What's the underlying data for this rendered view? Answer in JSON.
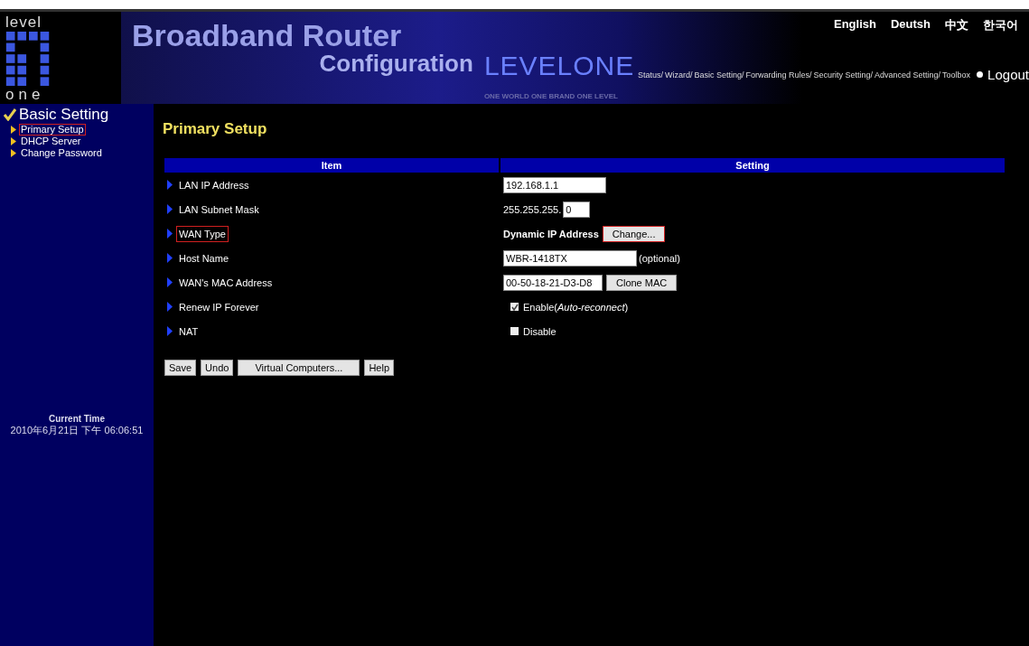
{
  "logo": {
    "top": "level",
    "bottom": "one"
  },
  "banner": {
    "title": "Broadband Router",
    "subtitle": "Configuration",
    "brand": "LEVELONE",
    "tagline": "ONE WORLD ONE BRAND ONE LEVEL"
  },
  "languages": [
    "English",
    "Deutsh",
    "中文",
    "한국어"
  ],
  "nav": [
    "Status/",
    "Wizard/",
    "Basic Setting/",
    "Forwarding Rules/",
    "Security Setting/",
    "Advanced Setting/",
    "Toolbox"
  ],
  "logout": "Logout",
  "sidebar": {
    "section": "Basic Setting",
    "items": [
      {
        "label": "Primary Setup",
        "highlighted": true
      },
      {
        "label": "DHCP Server",
        "highlighted": false
      },
      {
        "label": "Change Password",
        "highlighted": false
      }
    ],
    "time_label": "Current Time",
    "time": "2010年6月21日 下午 06:06:51"
  },
  "page_title": "Primary Setup",
  "table": {
    "columns": [
      "Item",
      "Setting"
    ],
    "rows": [
      {
        "label": "LAN IP Address",
        "highlighted": false,
        "kind": "input",
        "value": "192.168.1.1"
      },
      {
        "label": "LAN Subnet Mask",
        "highlighted": false,
        "kind": "prefix-input",
        "prefix": "255.255.255.",
        "value": "0"
      },
      {
        "label": "WAN Type",
        "highlighted": true,
        "kind": "text-button",
        "text": "Dynamic IP Address",
        "button": "Change...",
        "button_highlighted": true
      },
      {
        "label": "Host Name",
        "highlighted": false,
        "kind": "input-note",
        "value": "WBR-1418TX",
        "note": "(optional)"
      },
      {
        "label": "WAN's MAC Address",
        "highlighted": false,
        "kind": "input-button",
        "value": "00-50-18-21-D3-D8",
        "button": "Clone MAC"
      },
      {
        "label": "Renew IP Forever",
        "highlighted": false,
        "kind": "checkbox",
        "checked": true,
        "text": "Enable(*Auto-reconnect*)"
      },
      {
        "label": "NAT",
        "highlighted": false,
        "kind": "checkbox",
        "checked": false,
        "text": "Disable"
      }
    ]
  },
  "buttons": [
    "Save",
    "Undo",
    "Virtual Computers...",
    "Help"
  ]
}
